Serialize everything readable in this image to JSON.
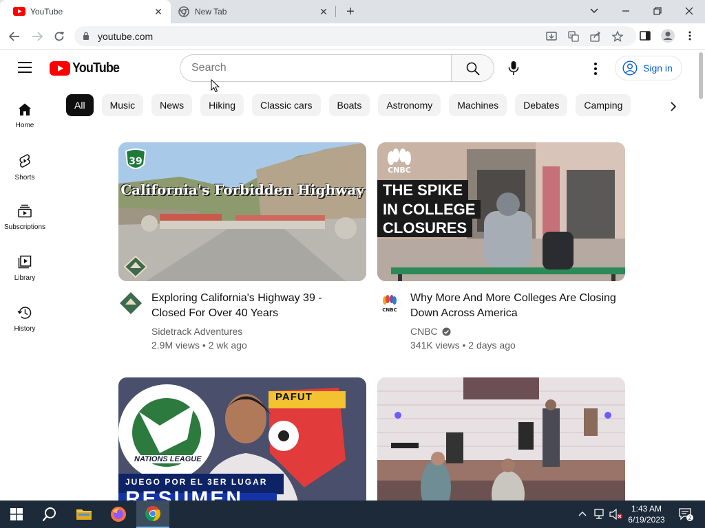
{
  "browser": {
    "tabs": [
      {
        "title": "YouTube",
        "active": true
      },
      {
        "title": "New Tab",
        "active": false
      }
    ],
    "url": "youtube.com"
  },
  "youtube": {
    "logo_text": "YouTube",
    "search_placeholder": "Search",
    "signin_label": "Sign in",
    "sidebar": [
      {
        "label": "Home",
        "icon": "home-icon"
      },
      {
        "label": "Shorts",
        "icon": "shorts-icon"
      },
      {
        "label": "Subscriptions",
        "icon": "subscriptions-icon"
      },
      {
        "label": "Library",
        "icon": "library-icon"
      },
      {
        "label": "History",
        "icon": "history-icon"
      }
    ],
    "chips": [
      "All",
      "Music",
      "News",
      "Hiking",
      "Classic cars",
      "Boats",
      "Astronomy",
      "Machines",
      "Debates",
      "Camping"
    ],
    "selected_chip": "All",
    "videos": [
      {
        "title": "Exploring California's Highway 39 - Closed For Over 40 Years",
        "channel": "Sidetrack Adventures",
        "stats": "2.9M views • 2 wk ago",
        "thumb_text": "California's Forbidden Highway",
        "thumb_badge": "39",
        "verified": false
      },
      {
        "title": "Why More And More Colleges Are Closing Down Across America",
        "channel": "CNBC",
        "stats": "341K views • 2 days ago",
        "thumb_text_lines": [
          "THE SPIKE",
          "IN COLLEGE",
          "CLOSURES"
        ],
        "thumb_logo": "CNBC",
        "verified": true
      },
      {
        "title": "",
        "thumb_text": "PAFUT",
        "thumb_subtext": "JUEGO POR EL 3ER LUGAR",
        "thumb_big": "RESUMEN",
        "thumb_league": "NATIONS LEAGUE"
      },
      {
        "title": ""
      }
    ]
  },
  "taskbar": {
    "time": "1:43 AM",
    "date": "6/19/2023",
    "notification_count": "2"
  },
  "colors": {
    "youtube_red": "#ff0000",
    "link_blue": "#065fd4",
    "taskbar": "#1c2a3a"
  }
}
